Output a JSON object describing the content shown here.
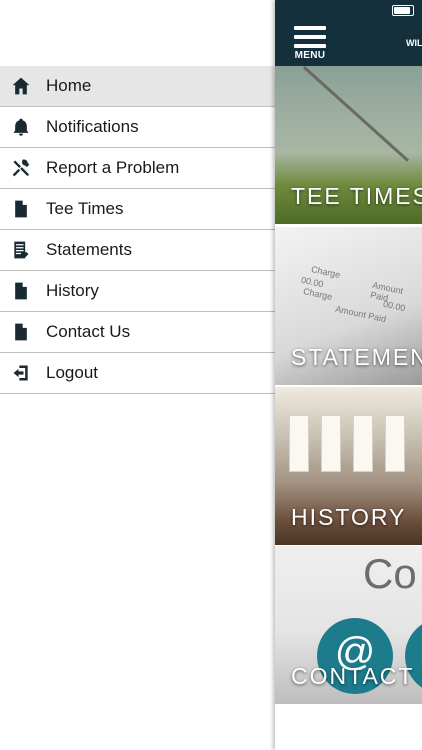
{
  "drawer": {
    "items": [
      {
        "label": "Home",
        "icon": "home-icon",
        "active": true
      },
      {
        "label": "Notifications",
        "icon": "bell-icon",
        "active": false
      },
      {
        "label": "Report a Problem",
        "icon": "tools-icon",
        "active": false
      },
      {
        "label": "Tee Times",
        "icon": "document-icon",
        "active": false
      },
      {
        "label": "Statements",
        "icon": "statement-icon",
        "active": false
      },
      {
        "label": "History",
        "icon": "document-icon",
        "active": false
      },
      {
        "label": "Contact Us",
        "icon": "document-icon",
        "active": false
      },
      {
        "label": "Logout",
        "icon": "logout-icon",
        "active": false
      }
    ]
  },
  "topbar": {
    "menu_label": "MENU",
    "title": "WIL",
    "background": "#13303c"
  },
  "tiles": [
    {
      "label": "TEE TIMES"
    },
    {
      "label": "STATEMENTS"
    },
    {
      "label": "HISTORY"
    },
    {
      "label": "CONTACT US"
    }
  ],
  "statement_image": {
    "col1": "Charge",
    "col2": "Amount Paid",
    "val": "00.00"
  },
  "contact_image": {
    "text": "Co",
    "at_symbol": "@"
  },
  "colors": {
    "active_row": "#e6e6e6",
    "icon": "#1a2a33",
    "contact_circle": "#1c7c8c"
  }
}
